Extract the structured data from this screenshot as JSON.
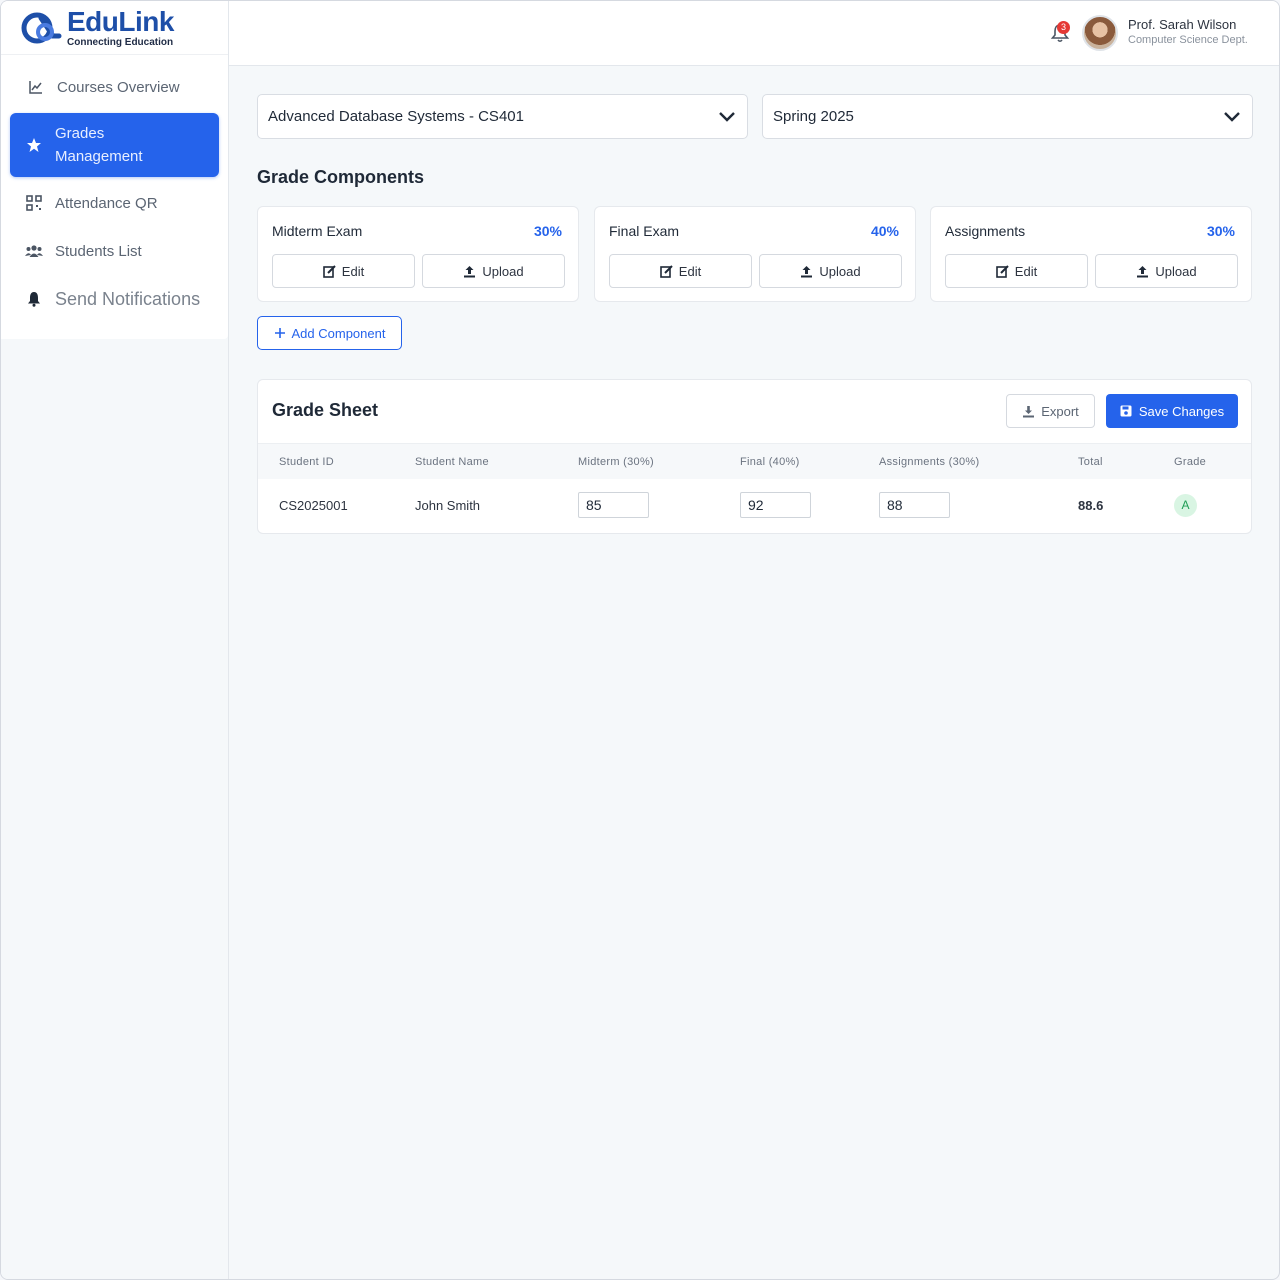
{
  "brand": {
    "name": "EduLink",
    "tagline": "Connecting Education"
  },
  "sidebar": {
    "items": [
      {
        "label": "Courses Overview",
        "icon": "chart-line-icon"
      },
      {
        "label": "Grades Management",
        "icon": "star-icon",
        "active": true
      },
      {
        "label": "Attendance QR",
        "icon": "qr-code-icon"
      },
      {
        "label": "Students List",
        "icon": "users-icon"
      },
      {
        "label": "Send Notifications",
        "icon": "bell-icon"
      }
    ]
  },
  "header": {
    "notification_count": "3",
    "user": {
      "name": "Prof. Sarah Wilson",
      "dept": "Computer Science Dept."
    }
  },
  "filters": {
    "course": "Advanced Database Systems - CS401",
    "term": "Spring 2025"
  },
  "components": {
    "title": "Grade Components",
    "items": [
      {
        "name": "Midterm Exam",
        "weight": "30%"
      },
      {
        "name": "Final Exam",
        "weight": "40%"
      },
      {
        "name": "Assignments",
        "weight": "30%"
      }
    ],
    "edit_label": "Edit",
    "upload_label": "Upload",
    "add_label": "Add Component"
  },
  "sheet": {
    "title": "Grade Sheet",
    "export_label": "Export",
    "save_label": "Save Changes",
    "columns": [
      "Student ID",
      "Student Name",
      "Midterm (30%)",
      "Final (40%)",
      "Assignments (30%)",
      "Total",
      "Grade"
    ],
    "rows": [
      {
        "id": "CS2025001",
        "name": "John Smith",
        "midterm": "85",
        "final": "92",
        "assignments": "88",
        "total": "88.6",
        "grade": "A"
      }
    ]
  },
  "colors": {
    "accent": "#2563eb",
    "brand": "#1e4fa8",
    "badge": "#e53935",
    "grade_bg": "#d9f5e3",
    "grade_text": "#1f9d55"
  }
}
